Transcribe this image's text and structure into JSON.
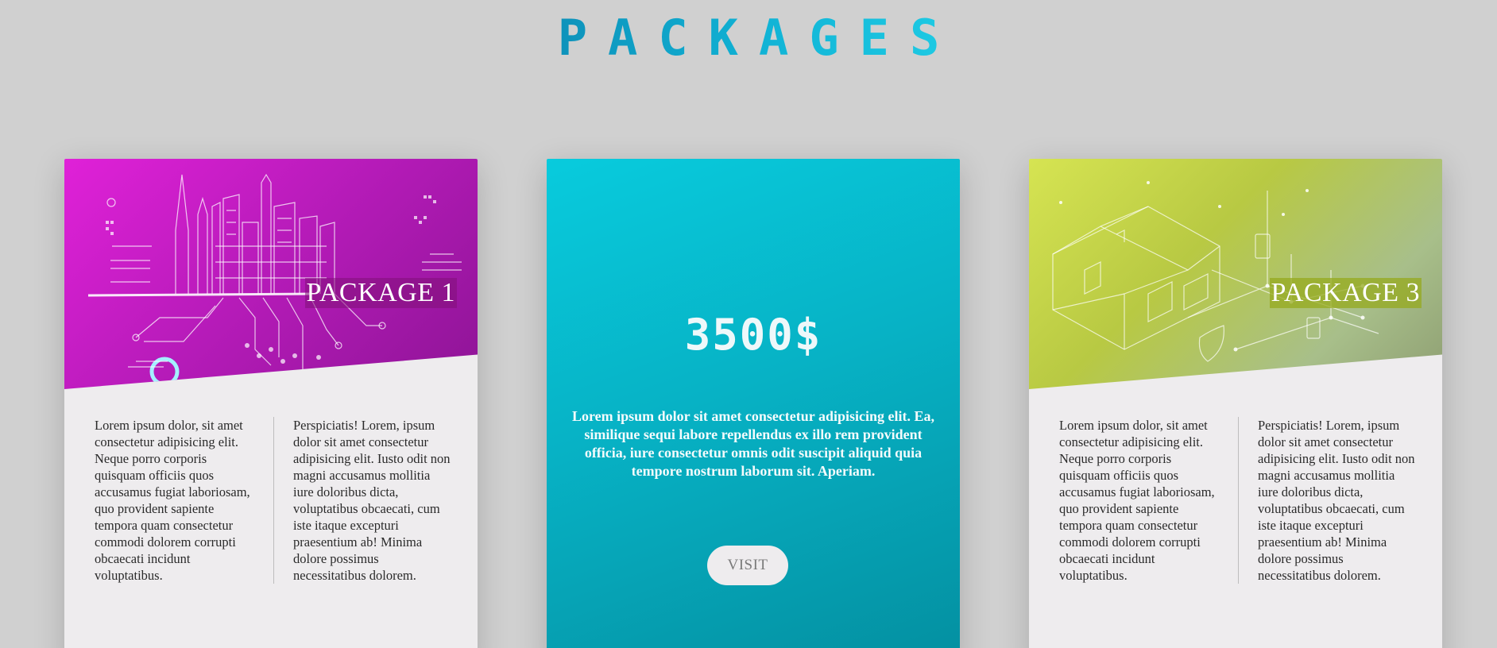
{
  "page": {
    "title": "PACKAGES"
  },
  "cards": {
    "left": {
      "label": "PACKAGE 1",
      "text_left": "Lorem ipsum dolor, sit amet consectetur adipisicing elit. Neque porro corporis quisquam officiis quos accusamus fugiat laboriosam, quo provident sapiente tempora quam consectetur commodi dolorem corrupti obcaecati incidunt voluptatibus.",
      "text_right": "Perspiciatis! Lorem, ipsum dolor sit amet consectetur adipisicing elit. Iusto odit non magni accusamus mollitia iure doloribus dicta, voluptatibus obcaecati, cum iste itaque excepturi praesentium ab! Minima dolore possimus necessitatibus dolorem.",
      "header_color": "#c41ec8"
    },
    "middle": {
      "price": "3500$",
      "description": "Lorem ipsum dolor sit amet consectetur adipisicing elit. Ea, similique sequi labore repellendus ex illo rem provident officia, iure consectetur omnis odit suscipit aliquid quia tempore nostrum laborum sit. Aperiam.",
      "button_label": "VISIT",
      "background_color": "#07b2c5"
    },
    "right": {
      "label": "PACKAGE 3",
      "text_left": "Lorem ipsum dolor, sit amet consectetur adipisicing elit. Neque porro corporis quisquam officiis quos accusamus fugiat laboriosam, quo provident sapiente tempora quam consectetur commodi dolorem corrupti obcaecati incidunt voluptatibus.",
      "text_right": "Perspiciatis! Lorem, ipsum dolor sit amet consectetur adipisicing elit. Iusto odit non magni accusamus mollitia iure doloribus dicta, voluptatibus obcaecati, cum iste itaque excepturi praesentium ab! Minima dolore possimus necessitatibus dolorem.",
      "header_color": "#c6d64c"
    }
  },
  "icons": {
    "left_illustration": "city-circuit-illustration",
    "right_illustration": "smart-house-illustration"
  }
}
